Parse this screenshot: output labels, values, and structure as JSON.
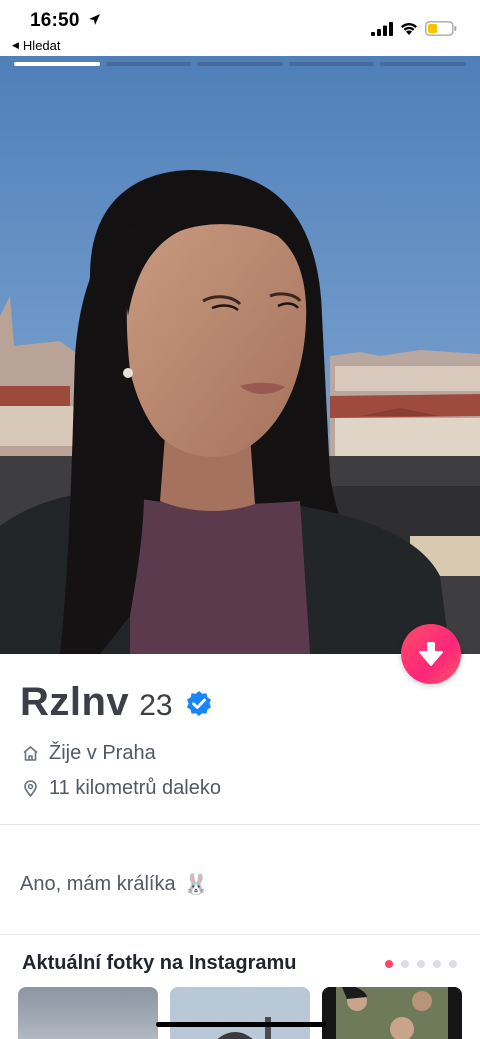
{
  "status_bar": {
    "time": "16:50",
    "back_label": "Hledat",
    "battery_color": "#f5c400"
  },
  "photo": {
    "progress_segments": 5,
    "active_segment": 0
  },
  "profile": {
    "name": "Rzlnv",
    "age": "23",
    "verified": true,
    "lives_in": "Žije v Praha",
    "distance": "11 kilometrů daleko",
    "bio": "Ano, mám králíka",
    "bio_emoji": "🐰"
  },
  "instagram": {
    "title": "Aktuální fotky na Instagramu",
    "page_count": 5,
    "active_page": 0
  },
  "colors": {
    "accent": "#fd4667",
    "verified_blue": "#1786f8",
    "text_dark": "#3c3f47",
    "text_muted": "#505965"
  }
}
